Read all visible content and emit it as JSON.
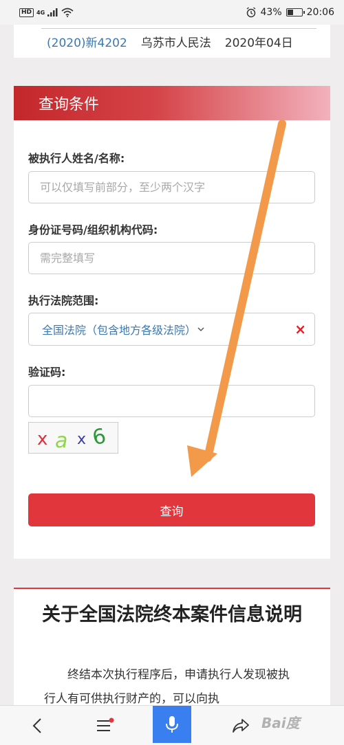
{
  "status_bar": {
    "hd": "HD",
    "network": "4G",
    "alarm_icon": "alarm-icon",
    "battery_percent": "43%",
    "battery_level": 0.43,
    "time": "20:06"
  },
  "top_row": {
    "case_no": "(2020)新4202",
    "court": "乌苏市人民法",
    "date": "2020年04日"
  },
  "query": {
    "header": "查询条件",
    "name_label": "被执行人姓名/名称:",
    "name_placeholder": "可以仅填写前部分，至少两个汉字",
    "id_label": "身份证号码/组织机构代码:",
    "id_placeholder": "需完整填写",
    "court_label": "执行法院范围:",
    "court_value": "全国法院（包含地方各级法院）",
    "court_clear": "×",
    "captcha_label": "验证码:",
    "captcha_text": "xax6",
    "submit_label": "查询"
  },
  "info": {
    "title": "关于全国法院终本案件信息说明",
    "text": "终结本次执行程序后，申请执行人发现被执行人有可供执行财产的，可以向执"
  },
  "bottom_nav": {
    "back_icon": "back-icon",
    "menu_icon": "menu-icon",
    "voice_icon": "microphone-icon",
    "share_icon": "share-icon",
    "watermark": "Bai度"
  },
  "colors": {
    "accent_red": "#e2363d",
    "link_blue": "#3a78b4",
    "arrow_orange": "#f39a4a",
    "voice_blue": "#3a7ff0"
  }
}
